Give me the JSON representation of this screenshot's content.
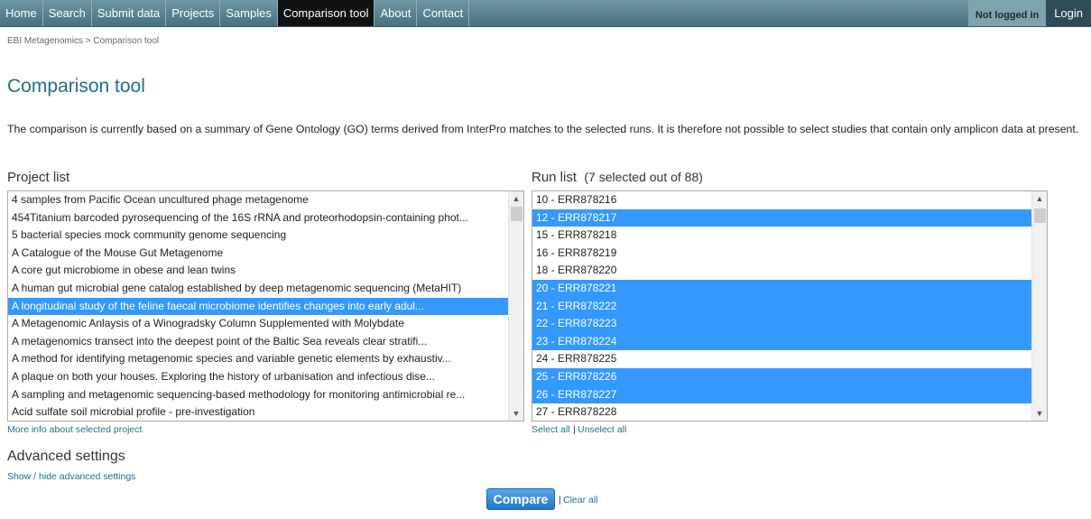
{
  "nav": {
    "items": [
      {
        "label": "Home"
      },
      {
        "label": "Search"
      },
      {
        "label": "Submit data"
      },
      {
        "label": "Projects"
      },
      {
        "label": "Samples"
      },
      {
        "label": "Comparison tool"
      },
      {
        "label": "About"
      },
      {
        "label": "Contact"
      }
    ],
    "active_index": 5,
    "status": "Not logged in",
    "login": "Login"
  },
  "breadcrumb": {
    "root": "EBI Metagenomics",
    "separator": " > ",
    "current": "Comparison tool"
  },
  "page_title": "Comparison tool",
  "intro": "The comparison is currently based on a summary of Gene Ontology (GO) terms derived from InterPro matches to the selected runs. It is therefore not possible to select studies that contain only amplicon data at present.",
  "project_list": {
    "label": "Project list",
    "items": [
      {
        "label": "4 samples from Pacific Ocean uncultured phage metagenome",
        "selected": false
      },
      {
        "label": "454Titanium barcoded pyrosequencing of the 16S rRNA and proteorhodopsin-containing phot...",
        "selected": false
      },
      {
        "label": "5 bacterial species mock community genome sequencing",
        "selected": false
      },
      {
        "label": "A Catalogue of the Mouse Gut Metagenome",
        "selected": false
      },
      {
        "label": "A core gut microbiome in obese and lean twins",
        "selected": false
      },
      {
        "label": "A human gut microbial gene catalog established by deep metagenomic sequencing (MetaHIT)",
        "selected": false
      },
      {
        "label": "A longitudinal study of the feline faecal microbiome identifies changes into early adul...",
        "selected": true
      },
      {
        "label": "A Metagenomic Anlaysis of a Winogradsky Column Supplemented with Molybdate",
        "selected": false
      },
      {
        "label": "A metagenomics transect into the deepest point of the Baltic Sea reveals clear stratifi...",
        "selected": false
      },
      {
        "label": "A method for identifying metagenomic species and variable genetic elements by exhaustiv...",
        "selected": false
      },
      {
        "label": "A plaque on both your houses. Exploring the history of urbanisation and infectious dise...",
        "selected": false
      },
      {
        "label": "A sampling and metagenomic sequencing-based methodology for monitoring antimicrobial re...",
        "selected": false
      },
      {
        "label": "Acid sulfate soil microbial profile - pre-investigation",
        "selected": false
      }
    ],
    "more_info_link": "More info about selected project"
  },
  "run_list": {
    "label": "Run list",
    "count_text": "(7 selected out of 88)",
    "items": [
      {
        "label": "10 - ERR878216",
        "selected": false
      },
      {
        "label": "12 - ERR878217",
        "selected": true
      },
      {
        "label": "15 - ERR878218",
        "selected": false
      },
      {
        "label": "16 - ERR878219",
        "selected": false
      },
      {
        "label": "18 - ERR878220",
        "selected": false
      },
      {
        "label": "20 - ERR878221",
        "selected": true
      },
      {
        "label": "21 - ERR878222",
        "selected": true
      },
      {
        "label": "22 - ERR878223",
        "selected": true
      },
      {
        "label": "23 - ERR878224",
        "selected": true
      },
      {
        "label": "24 - ERR878225",
        "selected": false
      },
      {
        "label": "25 - ERR878226",
        "selected": true
      },
      {
        "label": "26 - ERR878227",
        "selected": true
      },
      {
        "label": "27 - ERR878228",
        "selected": false
      }
    ],
    "select_all": "Select all",
    "separator": "|",
    "unselect_all": "Unselect all"
  },
  "advanced": {
    "title": "Advanced settings",
    "toggle_link": "Show / hide advanced settings"
  },
  "actions": {
    "compare": "Compare",
    "separator": "|",
    "clear_all": "Clear all"
  },
  "icons": {
    "scroll_up": "scroll-up-arrow-icon",
    "scroll_down": "scroll-down-arrow-icon"
  },
  "colors": {
    "nav_bg": "#5b8593",
    "nav_active": "#111111",
    "title": "#1f6f8b",
    "link": "#1f6f8b",
    "selection": "#3399ff",
    "button": "#2a7fd4"
  }
}
